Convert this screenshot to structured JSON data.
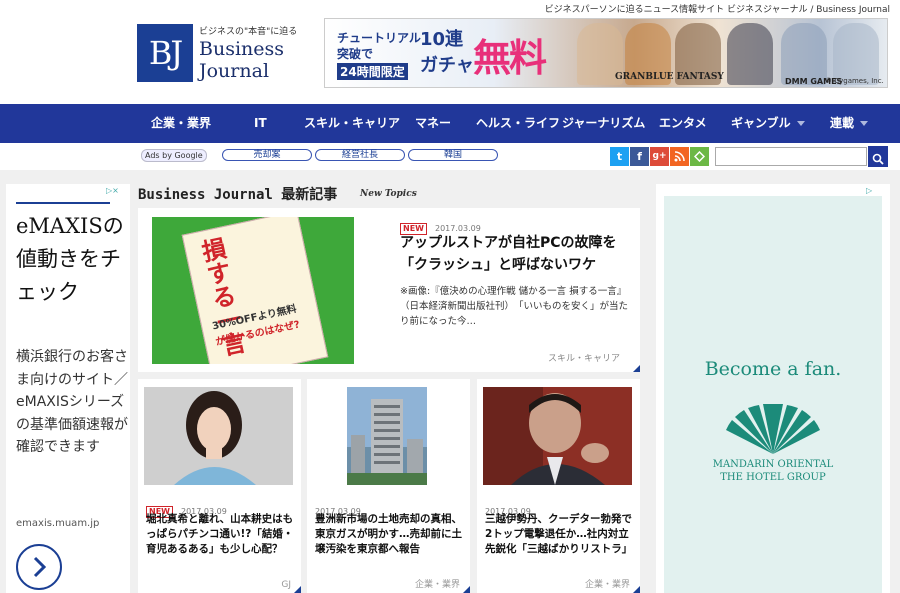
{
  "header": {
    "tagline": "ビジネスパーソンに迫るニュース情報サイト ビジネスジャーナル / Business Journal",
    "logo_mark": "BJ",
    "logo_sub": "ビジネスの\"本音\"に迫る",
    "logo_line1": "Business",
    "logo_line2": "Journal"
  },
  "banner": {
    "line1": "チュートリアル",
    "line2": "突破で",
    "line3": "24時間限定",
    "gacha1": "10連",
    "gacha2": "ガチャ",
    "free": "無料",
    "game": "GRANBLUE FANTASY",
    "publisher": "DMM GAMES",
    "copyright": "© Cygames, Inc."
  },
  "nav": {
    "items": [
      "企業・業界",
      "IT",
      "スキル・キャリア",
      "マネー",
      "ヘルス・ライフ",
      "ジャーナリズム",
      "エンタメ",
      "ギャンブル",
      "連載"
    ]
  },
  "keywords": {
    "ads_label": "Ads by Google",
    "items": [
      "売却案",
      "経営社長",
      "韓国"
    ]
  },
  "search": {
    "placeholder": ""
  },
  "left_ad": {
    "choice": "▷×",
    "headline": "eMAXISの値動きをチェック",
    "body": "横浜銀行のお客さま向けのサイト／eMAXISシリーズの基準価額速報が確認できます",
    "url": "emaxis.muam.jp"
  },
  "section": {
    "title": "Business Journal 最新記事",
    "subtitle": "New Topics"
  },
  "featured": {
    "badge": "NEW",
    "date": "2017.03.09",
    "title": "アップルストアが自社PCの故障を「クラッシュ」と呼ばないワケ",
    "excerpt": "※画像:『億決めの心理作戦 儲かる一言 損する一言』（日本経済新聞出版社刊）　「いいものを安く」が当たり前になった今…",
    "category": "スキル・キャリア",
    "book_title": "損する一言",
    "book_line1": "30%OFFより無料",
    "book_line2": "が儲かるのはなぜ?"
  },
  "cards": [
    {
      "badge": "NEW",
      "date": "2017.03.09",
      "title": "堀北真希と離れ、山本耕史はもっぱらパチンコ通い!?「結婚・育児あるある」も少し心配？",
      "category": "GJ"
    },
    {
      "badge": "",
      "date": "2017.03.09",
      "title": "豊洲新市場の土地売却の真相、東京ガスが明かす…売却前に土壌汚染を東京都へ報告",
      "category": "企業・業界"
    },
    {
      "badge": "",
      "date": "2017.03.09",
      "title": "三越伊勢丹、クーデター勃発で2トップ電撃退任か…社内対立先鋭化「三越ばかりリストラ」",
      "category": "企業・業界"
    }
  ],
  "right_ad": {
    "headline": "Become a fan.",
    "brand1": "MANDARIN ORIENTAL",
    "brand2": "THE HOTEL GROUP"
  },
  "colors": {
    "nav_bg": "#21379a",
    "brand_blue": "#1b3f94",
    "new_red": "#d0242a",
    "mandarin_teal": "#1c8b7a"
  }
}
